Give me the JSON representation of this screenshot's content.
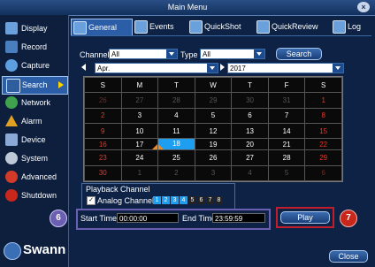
{
  "window": {
    "title": "Main Menu",
    "close_icon": "close-icon"
  },
  "sidebar": {
    "items": [
      {
        "label": "Display",
        "icon": "display-icon",
        "color": "#6aa1dd"
      },
      {
        "label": "Record",
        "icon": "record-icon",
        "color": "#4a7fbf"
      },
      {
        "label": "Capture",
        "icon": "camera-icon",
        "color": "#5da0e0"
      },
      {
        "label": "Search",
        "icon": "search-icon",
        "color": "#2f5e9e"
      },
      {
        "label": "Network",
        "icon": "network-icon",
        "color": "#3fa34d"
      },
      {
        "label": "Alarm",
        "icon": "alarm-icon",
        "color": "#e0a020"
      },
      {
        "label": "Device",
        "icon": "device-icon",
        "color": "#8aa9d6"
      },
      {
        "label": "System",
        "icon": "gear-icon",
        "color": "#bfc8d6"
      },
      {
        "label": "Advanced",
        "icon": "advanced-icon",
        "color": "#d23a2a"
      },
      {
        "label": "Shutdown",
        "icon": "power-icon",
        "color": "#c8281c"
      }
    ],
    "active": "Search",
    "brand": "Swann"
  },
  "tabs": [
    {
      "label": "General",
      "active": true
    },
    {
      "label": "Events",
      "active": false
    },
    {
      "label": "QuickShot",
      "active": false
    },
    {
      "label": "QuickReview",
      "active": false
    },
    {
      "label": "Log",
      "active": false
    }
  ],
  "filters": {
    "channel_label": "Channel",
    "channel_value": "All",
    "type_label": "Type",
    "type_value": "All",
    "search_label": "Search"
  },
  "calendar": {
    "month": "Apr.",
    "year": "2017",
    "weekdays": [
      "S",
      "M",
      "T",
      "W",
      "T",
      "F",
      "S"
    ],
    "weeks": [
      [
        "26",
        "27",
        "28",
        "29",
        "30",
        "31",
        "1"
      ],
      [
        "2",
        "3",
        "4",
        "5",
        "6",
        "7",
        "8"
      ],
      [
        "9",
        "10",
        "11",
        "12",
        "13",
        "14",
        "15"
      ],
      [
        "16",
        "17",
        "18",
        "19",
        "20",
        "21",
        "22"
      ],
      [
        "23",
        "24",
        "25",
        "26",
        "27",
        "28",
        "29"
      ],
      [
        "30",
        "1",
        "2",
        "3",
        "4",
        "5",
        "6"
      ]
    ],
    "selected_day": "18"
  },
  "playback": {
    "title": "Playback Channel",
    "analog_label": "Analog Channels",
    "analog_checked": true,
    "channels": [
      "1",
      "2",
      "3",
      "4",
      "5",
      "6",
      "7",
      "8"
    ],
    "selected_channels": [
      "1",
      "2",
      "3",
      "4"
    ]
  },
  "time": {
    "start_label": "Start Time",
    "start_value": "00:00:00",
    "end_label": "End Time",
    "end_value": "23:59:59"
  },
  "markers": {
    "six": "6",
    "seven": "7"
  },
  "actions": {
    "play_label": "Play",
    "close_label": "Close"
  }
}
